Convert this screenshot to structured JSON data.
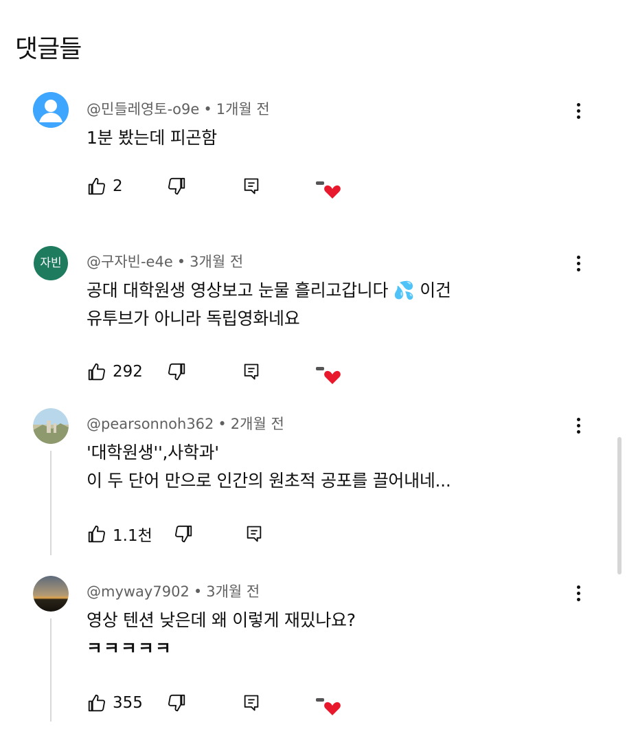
{
  "header": {
    "title": "댓글들"
  },
  "comments": [
    {
      "handle": "@민들레영토-o9e",
      "time": "1개월 전",
      "lines": [
        "1분 봤는데 피곤함"
      ],
      "likes": "2",
      "avatar_color": "#3ea6ff",
      "avatar_type": "default-person"
    },
    {
      "handle": "@구자빈-e4e",
      "time": "3개월 전",
      "lines": [
        "공대 대학원생 영상보고 눈물 흘리고갑니다 💦 이건",
        "유투브가 아니라 독립영화네요"
      ],
      "likes": "292",
      "avatar_color": "#1e7b5e",
      "avatar_text": "자빈"
    },
    {
      "handle": "@pearsonnoh362",
      "time": "2개월 전",
      "lines": [
        "'대학원생'',사학과'",
        "이 두 단어 만으로 인간의 원초적 공포를 끌어내네..."
      ],
      "likes": "1.1천",
      "avatar_type": "landscape-photo"
    },
    {
      "handle": "@myway7902",
      "time": "3개월 전",
      "lines": [
        "영상 텐션 낮은데 왜 이렇게 재밌나요?",
        "ㅋㅋㅋㅋㅋ"
      ],
      "likes": "355",
      "avatar_type": "sunset-photo"
    }
  ],
  "colors": {
    "meta_text": "#606060",
    "heart": "#e8192c",
    "icon_stroke": "#0f0f0f"
  },
  "icons": [
    "thumbs-up-icon",
    "thumbs-down-icon",
    "reply-icon",
    "creator-heart-icon",
    "more-vert-icon"
  ]
}
